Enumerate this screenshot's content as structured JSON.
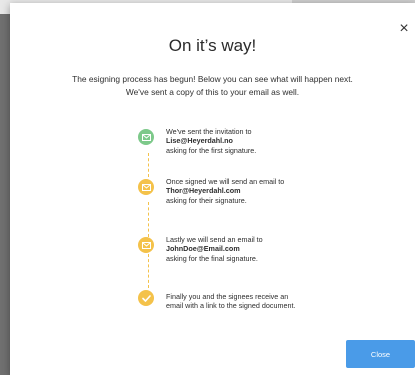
{
  "dialog": {
    "title": "On it’s way!",
    "lead": "The esigning process has begun! Below you can see what will happen next. We've sent a copy of this to your email as well.",
    "close_icon": "×",
    "close_button": "Close"
  },
  "steps": [
    {
      "status": "done",
      "icon": "envelope-icon",
      "line1": "We've sent the invitation to",
      "email": "Lise@Heyerdahl.no",
      "line3": "asking for the first signature."
    },
    {
      "status": "pending",
      "icon": "envelope-icon",
      "line1": "Once signed we will send an email to",
      "email": "Thor@Heyerdahl.com",
      "line3": "asking for their signature."
    },
    {
      "status": "pending",
      "icon": "envelope-icon",
      "line1": "Lastly we will send an email to",
      "email": "JohnDoe@Email.com",
      "line3": "asking for the final signature."
    },
    {
      "status": "pending",
      "icon": "checkmark-icon",
      "line1": "Finally you and the signees receive an",
      "email": "",
      "line3": "email with a link to the signed document."
    }
  ],
  "colors": {
    "done": "#7dc98a",
    "pending": "#f4c24a",
    "primary_button": "#4a9be8"
  }
}
